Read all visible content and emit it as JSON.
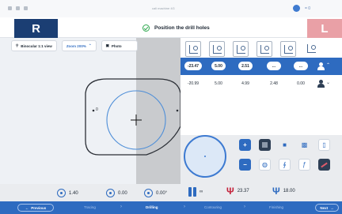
{
  "status_bar": {
    "center_text": "cali machine 4G",
    "right_small": "= 0"
  },
  "header": {
    "side_right": "R",
    "side_left": "L",
    "instruction": "Position the drill holes"
  },
  "viewer": {
    "view_mode": "Binocular 1:1 view",
    "zoom": "Zoom 200%",
    "photo": "Photo"
  },
  "shape": {
    "point_label": "0"
  },
  "table": {
    "active_row": [
      "-23.47",
      "5.00",
      "2.51",
      "...",
      "..."
    ],
    "row2": [
      "-20.99",
      "5.00",
      "4.99",
      "2.48",
      "0.00"
    ]
  },
  "infobar": {
    "depth": "1.40",
    "offset": "0.00",
    "angle": "0.00°",
    "count": "∞",
    "drill_a": "23.37",
    "drill_b": "18.00"
  },
  "bottom_nav": {
    "previous": "Previous",
    "steps": [
      "Tracing",
      "Drilling",
      "Contouring",
      "Finishing"
    ],
    "current_step": "Drilling",
    "next": "Next"
  },
  "colors": {
    "accent": "#2e6bc0",
    "side_right": "#1b3e73",
    "side_left": "#e9a0a6",
    "success": "#2fa84f"
  }
}
